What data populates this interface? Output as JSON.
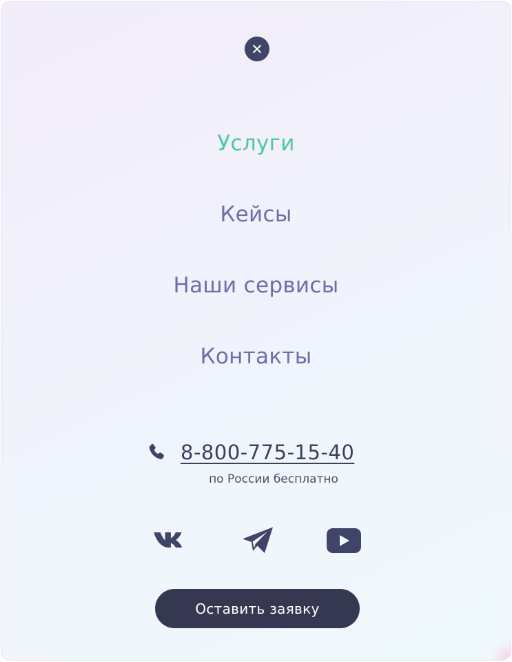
{
  "menu": {
    "close_icon": "close-icon",
    "items": [
      {
        "label": "Услуги",
        "active": true
      },
      {
        "label": "Кейсы",
        "active": false
      },
      {
        "label": "Наши сервисы",
        "active": false
      },
      {
        "label": "Контакты",
        "active": false
      }
    ]
  },
  "contact": {
    "phone_icon": "phone-icon",
    "phone": "8-800-775-15-40",
    "note": "по России бесплатно"
  },
  "social": [
    {
      "name": "vk",
      "icon": "vk-icon"
    },
    {
      "name": "telegram",
      "icon": "telegram-icon"
    },
    {
      "name": "youtube",
      "icon": "youtube-icon"
    }
  ],
  "cta": {
    "label": "Оставить заявку"
  },
  "colors": {
    "active": "#4dc7a6",
    "menu_text": "#6d6fa8",
    "dark": "#353850",
    "icon": "#3f4566"
  }
}
